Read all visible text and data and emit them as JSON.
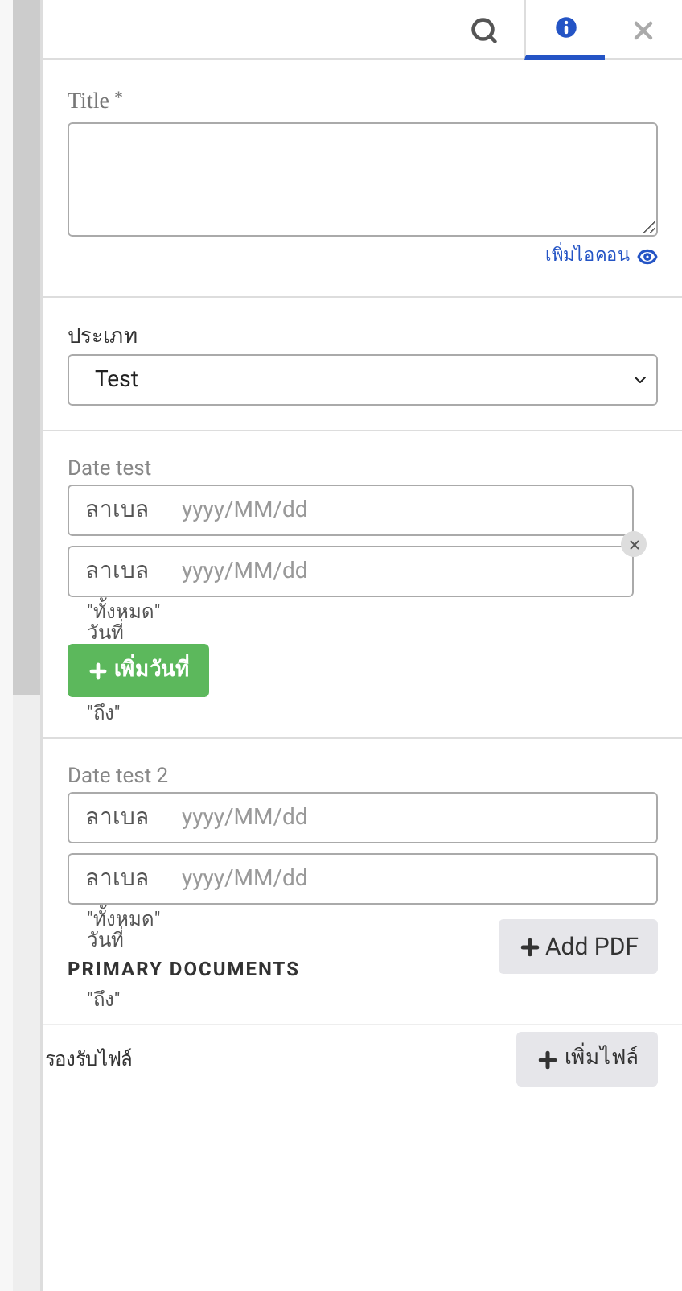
{
  "tabs": [
    {
      "kind": "search",
      "selected": false
    },
    {
      "kind": "info",
      "selected": true
    },
    {
      "kind": "close",
      "selected": false
    }
  ],
  "title_field": {
    "label": "Title",
    "required_mark": "*",
    "add_icon_link": "เพิ่มไอคอน"
  },
  "type_field": {
    "label": "ประเภท",
    "value": "Test"
  },
  "date_groups": [
    {
      "label": "Date test",
      "rows": [
        {
          "label": "ลาเบล",
          "placeholder": "yyyy/MM/dd"
        },
        {
          "label": "ลาเบล",
          "placeholder": "yyyy/MM/dd"
        }
      ],
      "removable": true,
      "notes": [
        "\"ทั้งหมด\"",
        "วันที่"
      ],
      "add_button": "เพิ่มวันที่",
      "to_note": "\"ถึง\""
    },
    {
      "label": "Date test 2",
      "rows": [
        {
          "label": "ลาเบล",
          "placeholder": "yyyy/MM/dd"
        },
        {
          "label": "ลาเบล",
          "placeholder": "yyyy/MM/dd"
        }
      ],
      "removable": false,
      "notes": [
        "\"ทั้งหมด\"",
        "วันที่"
      ],
      "to_note": "\"ถึง\""
    }
  ],
  "primary_documents": {
    "heading": "PRIMARY DOCUMENTS",
    "button": "Add PDF"
  },
  "files": {
    "label": "รองรับไฟล์",
    "button": "เพิ่มไฟล์"
  }
}
